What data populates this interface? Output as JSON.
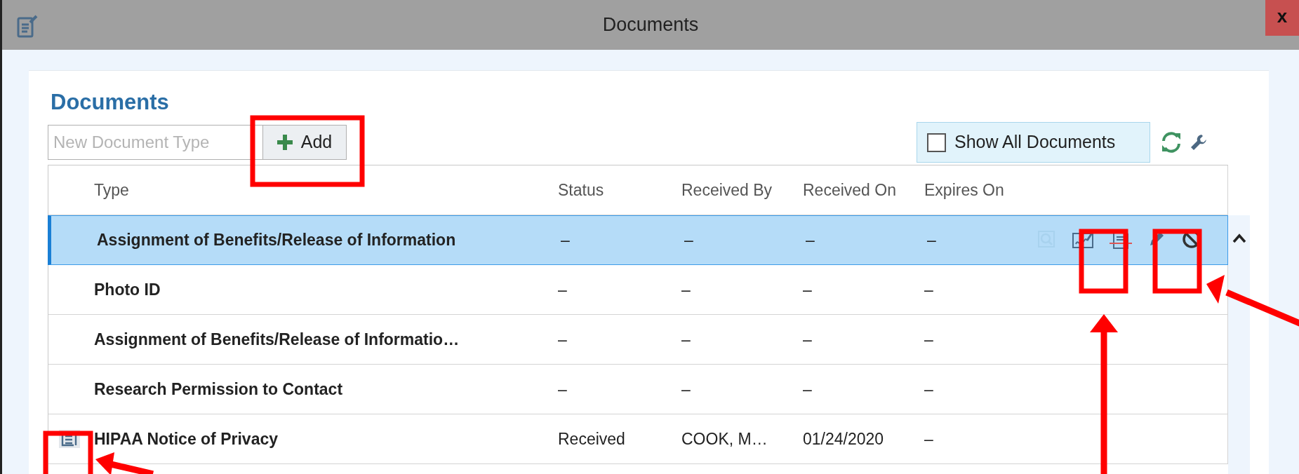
{
  "window": {
    "title": "Documents",
    "close_label": "x"
  },
  "heading": "Documents",
  "new_type_field": {
    "placeholder": "New Document Type"
  },
  "add_button": {
    "label": "Add"
  },
  "show_all": {
    "label": "Show All Documents",
    "checked": false
  },
  "table": {
    "columns": [
      "Type",
      "Status",
      "Received By",
      "Received On",
      "Expires On"
    ],
    "rows": [
      {
        "type": "Assignment of Benefits/Release of Information",
        "status": "–",
        "received_by": "–",
        "received_on": "–",
        "expires_on": "–",
        "selected": true,
        "show_icon": false,
        "actions": [
          {
            "kind": "preview",
            "disabled": true
          },
          {
            "kind": "sign",
            "disabled": false
          },
          {
            "kind": "document",
            "disabled": false
          },
          {
            "kind": "edit",
            "disabled": false
          },
          {
            "kind": "void",
            "disabled": false
          }
        ]
      },
      {
        "type": "Photo ID",
        "status": "–",
        "received_by": "–",
        "received_on": "–",
        "expires_on": "–",
        "selected": false,
        "show_icon": false
      },
      {
        "type": "Assignment of Benefits/Release of Informatio…",
        "status": "–",
        "received_by": "–",
        "received_on": "–",
        "expires_on": "–",
        "selected": false,
        "show_icon": false
      },
      {
        "type": "Research Permission to Contact",
        "status": "–",
        "received_by": "–",
        "received_on": "–",
        "expires_on": "–",
        "selected": false,
        "show_icon": false
      },
      {
        "type": "HIPAA Notice of Privacy",
        "status": "Received",
        "received_by": "COOK, M…",
        "received_on": "01/24/2020",
        "expires_on": "–",
        "selected": false,
        "show_icon": true
      }
    ]
  }
}
